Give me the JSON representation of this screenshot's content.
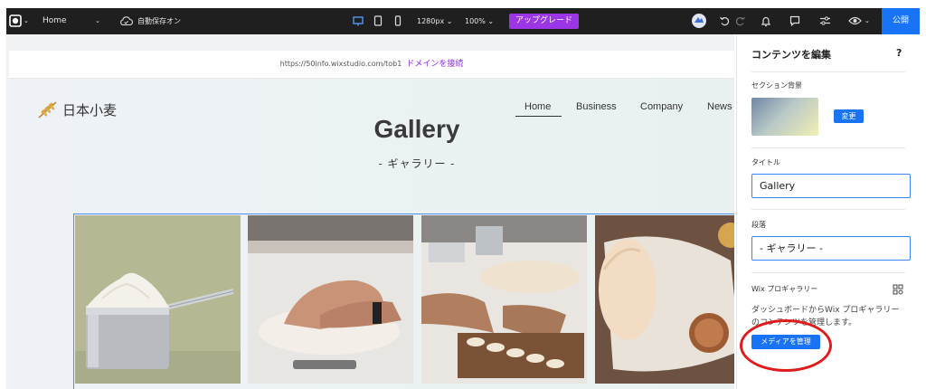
{
  "toolbar": {
    "page_name": "Home",
    "autosave": "自動保存オン",
    "resolution": "1280px",
    "zoom": "100%",
    "upgrade_label": "アップグレード",
    "publish_label": "公開"
  },
  "url_bar": {
    "url": "https://50info.wixstudio.com/tob1",
    "connect_domain": "ドメインを接続"
  },
  "site": {
    "logo_text": "日本小麦",
    "nav": [
      "Home",
      "Business",
      "Company",
      "News"
    ],
    "title": "Gallery",
    "subtitle": "- ギャラリー -"
  },
  "panel": {
    "title": "コンテンツを編集",
    "help": "?",
    "section_bg_label": "セクション背景",
    "change_button": "変更",
    "title_label": "タイトル",
    "title_value": "Gallery",
    "paragraph_label": "段落",
    "paragraph_value": "- ギャラリー -",
    "pro_gallery_label": "Wix プロギャラリー",
    "description": "ダッシュボードからWix プロギャラリーのコンテンツを管理します。",
    "manage_media_button": "メディアを管理"
  },
  "colors": {
    "accent": "#1873f5",
    "upgrade": "#9b35e6",
    "highlight_ring": "#e01b1b"
  }
}
